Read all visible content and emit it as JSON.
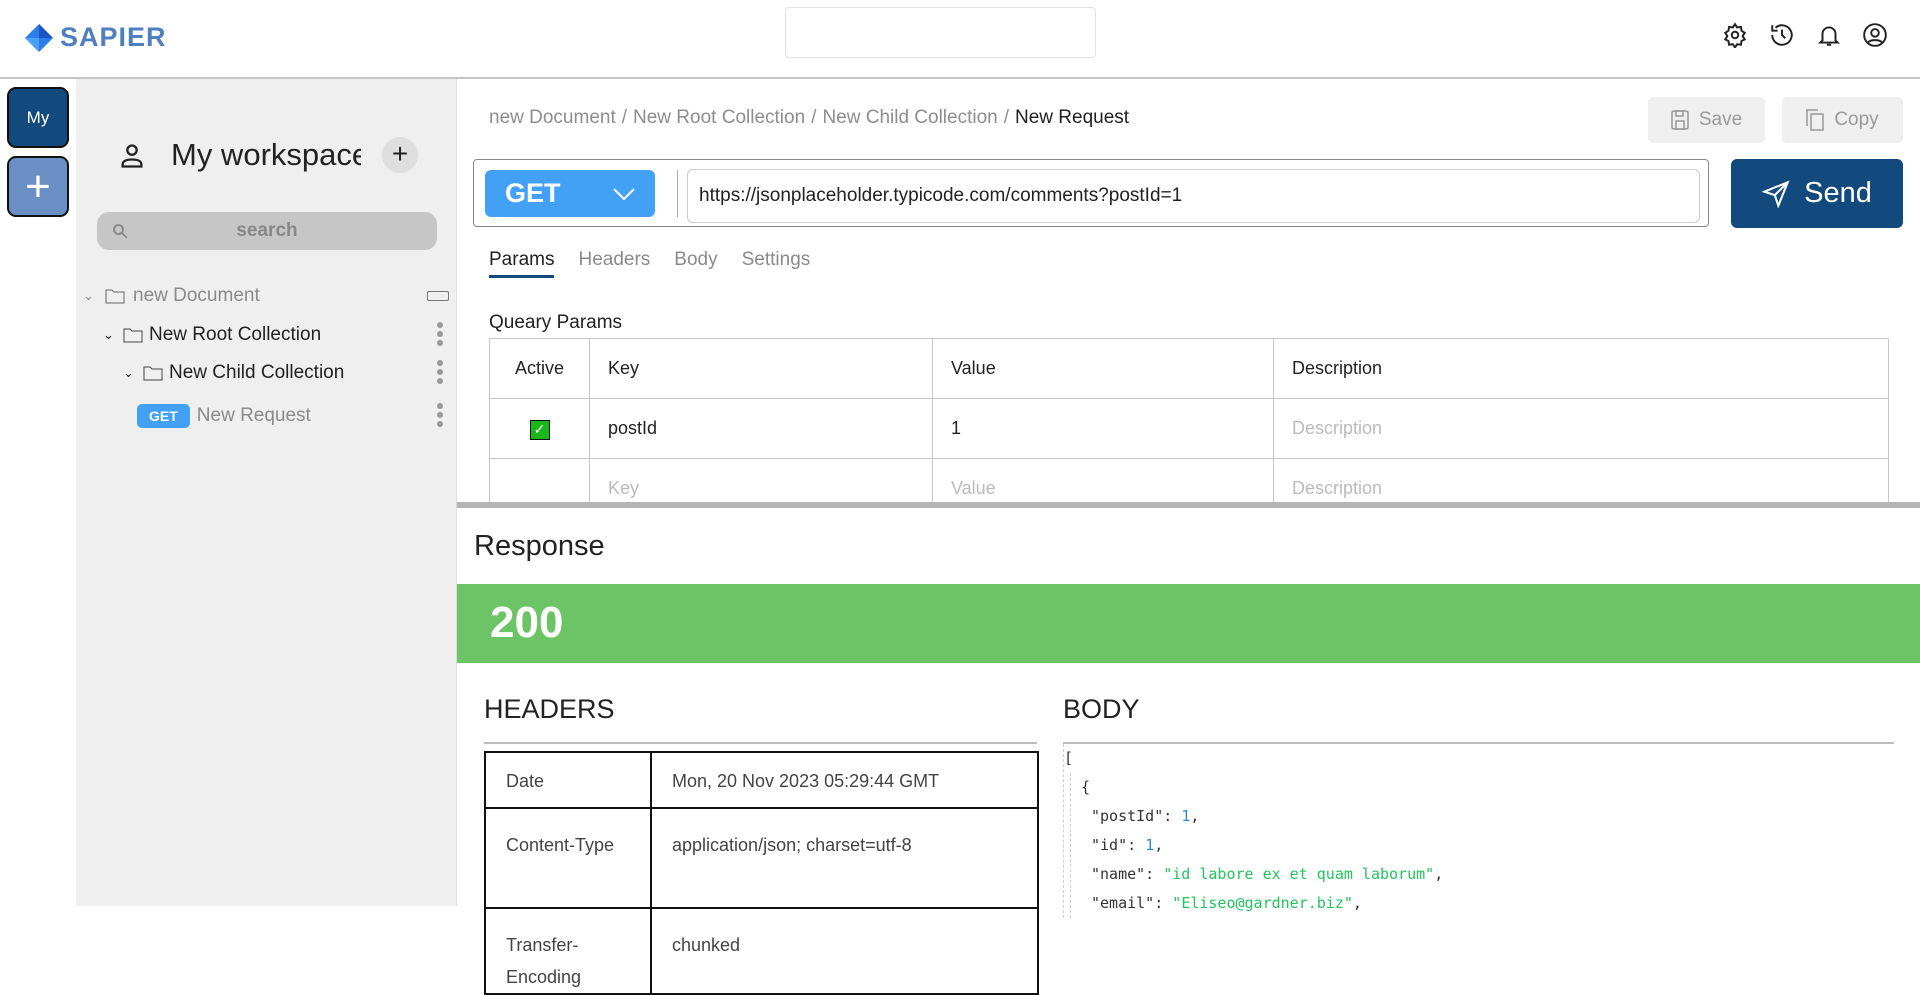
{
  "app": {
    "logo_text": "SAPIER",
    "top_icons": [
      "settings-icon",
      "history-icon",
      "bell-icon",
      "account-icon"
    ]
  },
  "rail": {
    "workspace_tile": "My",
    "add_tile": "+"
  },
  "sidebar": {
    "title": "My workspace",
    "search_placeholder": "search",
    "tree": [
      {
        "label": "new Document",
        "level": 0
      },
      {
        "label": "New Root Collection",
        "level": 1
      },
      {
        "label": "New Child Collection",
        "level": 2
      },
      {
        "label": "New Request",
        "level": 3,
        "method": "GET"
      }
    ]
  },
  "breadcrumb": {
    "items": [
      "new Document",
      "New Root Collection",
      "New Child Collection"
    ],
    "current": "New Request",
    "sep": "/"
  },
  "toolbar": {
    "save": "Save",
    "copy": "Copy",
    "send": "Send"
  },
  "request": {
    "method": "GET",
    "url": "https://jsonplaceholder.typicode.com/comments?postId=1"
  },
  "tabs": [
    "Params",
    "Headers",
    "Body",
    "Settings"
  ],
  "active_tab": "Params",
  "params": {
    "title": "Queary Params",
    "columns": [
      "Active",
      "Key",
      "Value",
      "Description"
    ],
    "rows": [
      {
        "active": true,
        "key": "postId",
        "value": "1",
        "description": "Description"
      }
    ],
    "empty": {
      "key": "Key",
      "value": "Value",
      "description": "Description"
    }
  },
  "response": {
    "title": "Response",
    "status": "200",
    "status_color": "#6dc466",
    "headers_title": "HEADERS",
    "body_title": "BODY",
    "headers": [
      {
        "k": "Date",
        "v": "Mon, 20 Nov 2023 05:29:44 GMT"
      },
      {
        "k": "Content-Type",
        "v": "application/json; charset=utf-8"
      },
      {
        "k": "Transfer-Encoding",
        "v": "chunked"
      }
    ],
    "body": {
      "open": "[",
      "obj_open": "{",
      "postId": "1",
      "id": "1",
      "name": "id labore ex et quam laborum",
      "email": "Eliseo@gardner.biz"
    }
  }
}
